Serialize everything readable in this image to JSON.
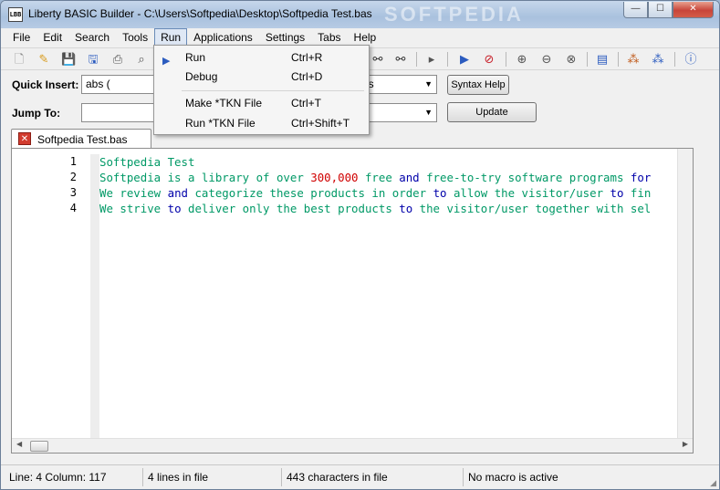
{
  "window": {
    "title": "Liberty BASIC Builder - C:\\Users\\Softpedia\\Desktop\\Softpedia Test.bas",
    "icon_text": "LBB",
    "watermark": "SOFTPEDIA",
    "minimize": "—",
    "maximize": "☐",
    "close": "✕"
  },
  "menubar": {
    "items": [
      "File",
      "Edit",
      "Search",
      "Tools",
      "Run",
      "Applications",
      "Settings",
      "Tabs",
      "Help"
    ],
    "active": "Run"
  },
  "run_menu": {
    "items": [
      {
        "label": "Run",
        "shortcut": "Ctrl+R"
      },
      {
        "label": "Debug",
        "shortcut": "Ctrl+D"
      },
      {
        "label": "Make *TKN File",
        "shortcut": "Ctrl+T"
      },
      {
        "label": "Run *TKN File",
        "shortcut": "Ctrl+Shift+T"
      }
    ]
  },
  "toolbar": {
    "icons": [
      "new-file-icon",
      "open-file-icon",
      "save-icon",
      "save-as-icon",
      "print-icon",
      "find-icon",
      "find-next-icon",
      "binoculars-icon",
      "run-to-icon",
      "run-icon",
      "no-debug-icon",
      "zoom-in-icon",
      "zoom-out-icon",
      "zoom-reset-icon",
      "properties-icon",
      "macro-record-icon",
      "macro-play-icon",
      "help-icon"
    ]
  },
  "quick_insert": {
    "label": "Quick Insert:",
    "value": "abs (",
    "second_value": "ds",
    "button": "Syntax Help"
  },
  "jump_to": {
    "label": "Jump To:",
    "value": "",
    "button": "Update"
  },
  "tab": {
    "label": "Softpedia Test.bas",
    "close": "✕"
  },
  "editor": {
    "lines": [
      {
        "num": "1",
        "segments": [
          {
            "t": "Softpedia Test",
            "c": "plain"
          }
        ]
      },
      {
        "num": "2",
        "segments": [
          {
            "t": "Softpedia is a library of over ",
            "c": "plain"
          },
          {
            "t": "300,000",
            "c": "num"
          },
          {
            "t": " free ",
            "c": "plain"
          },
          {
            "t": "and",
            "c": "kw"
          },
          {
            "t": " free-to-try software programs ",
            "c": "plain"
          },
          {
            "t": "for",
            "c": "kw"
          }
        ]
      },
      {
        "num": "3",
        "segments": [
          {
            "t": "We review ",
            "c": "plain"
          },
          {
            "t": "and",
            "c": "kw"
          },
          {
            "t": " categorize these products in order ",
            "c": "plain"
          },
          {
            "t": "to",
            "c": "kw"
          },
          {
            "t": " allow the visitor/user ",
            "c": "plain"
          },
          {
            "t": "to",
            "c": "kw"
          },
          {
            "t": " fin",
            "c": "plain"
          }
        ]
      },
      {
        "num": "4",
        "segments": [
          {
            "t": "We strive ",
            "c": "plain"
          },
          {
            "t": "to",
            "c": "kw"
          },
          {
            "t": " deliver only the best products ",
            "c": "plain"
          },
          {
            "t": "to",
            "c": "kw"
          },
          {
            "t": " the visitor/user together with sel",
            "c": "plain"
          }
        ]
      }
    ]
  },
  "statusbar": {
    "position": "Line: 4 Column: 117",
    "lines": "4 lines in file",
    "chars": "443 characters in file",
    "macro": "No macro is active"
  },
  "colors": {
    "code_plain": "#009966",
    "code_keyword": "#0000aa",
    "code_number": "#d00000"
  }
}
